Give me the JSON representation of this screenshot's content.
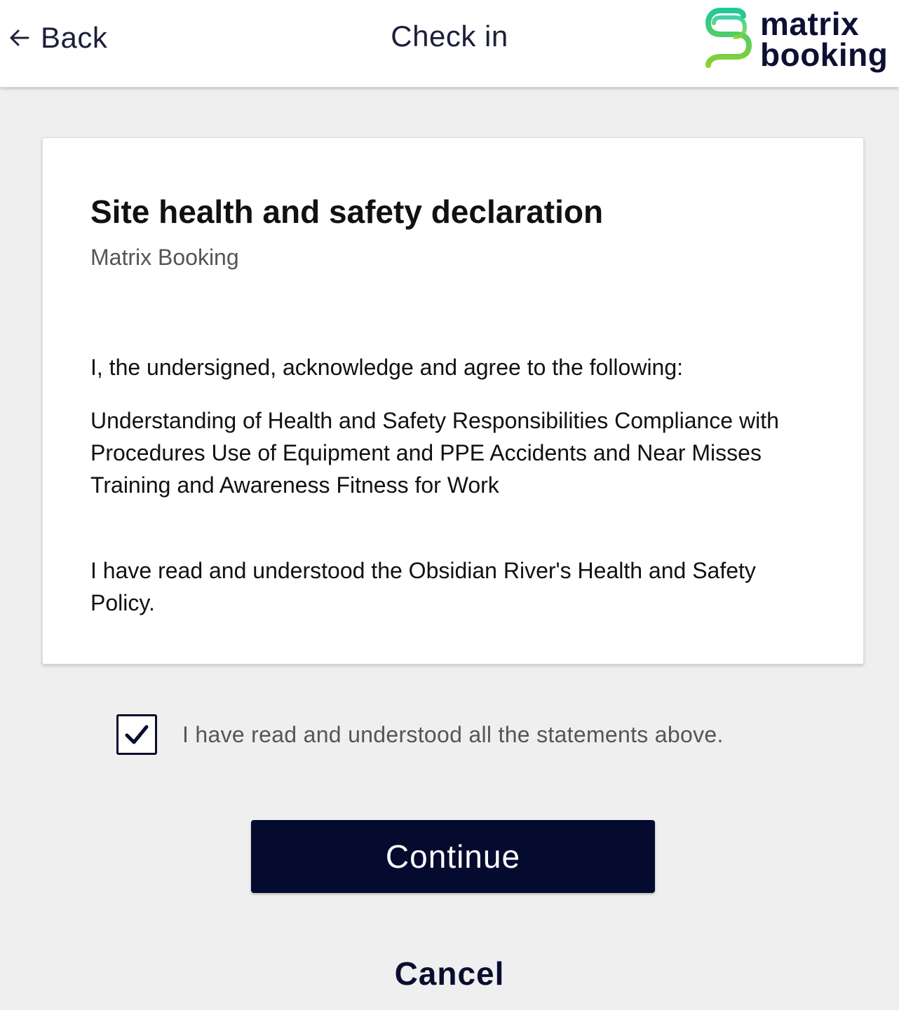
{
  "header": {
    "back_label": "Back",
    "title": "Check in",
    "logo": {
      "line1": "matrix",
      "line2": "booking",
      "colors": [
        "#20c997",
        "#8bd22e"
      ]
    }
  },
  "declaration": {
    "title": "Site health and safety declaration",
    "subtitle": "Matrix Booking",
    "paragraphs": [
      "I, the undersigned, acknowledge and agree to the following:",
      "Understanding of Health and Safety Responsibilities Compliance with Procedures Use of Equipment and PPE Accidents and Near Misses Training and Awareness Fitness for Work",
      "I have read and understood the Obsidian River's Health and Safety Policy."
    ]
  },
  "acknowledge": {
    "checked": true,
    "label": "I have read and understood all the statements above."
  },
  "actions": {
    "continue_label": "Continue",
    "cancel_label": "Cancel"
  },
  "colors": {
    "primary": "#050a2f",
    "background": "#efefef"
  }
}
